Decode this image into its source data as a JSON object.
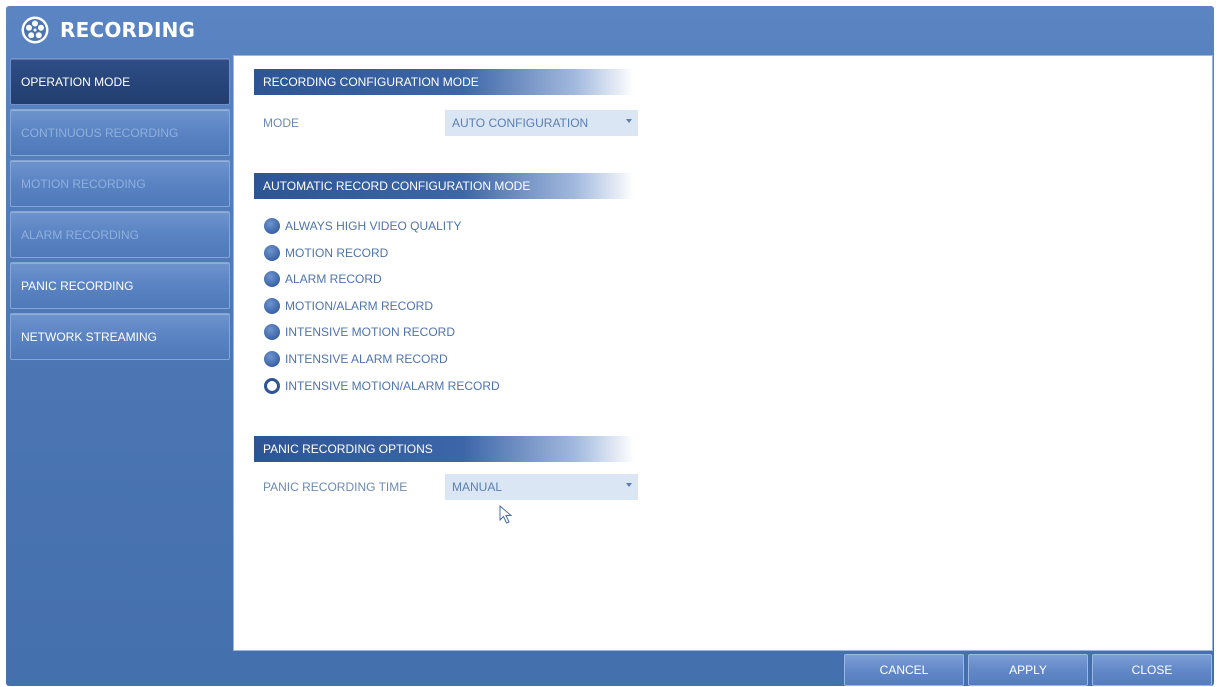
{
  "window": {
    "title": "RECORDING",
    "icon": "film-reel-icon"
  },
  "sidebar": {
    "items": [
      {
        "label": "OPERATION MODE",
        "state": "active"
      },
      {
        "label": "CONTINUOUS RECORDING",
        "state": "disabled"
      },
      {
        "label": "MOTION RECORDING",
        "state": "disabled"
      },
      {
        "label": "ALARM RECORDING",
        "state": "disabled"
      },
      {
        "label": "PANIC RECORDING",
        "state": "normal"
      },
      {
        "label": "NETWORK STREAMING",
        "state": "normal"
      }
    ]
  },
  "main": {
    "config_section": {
      "header": "RECORDING CONFIGURATION MODE",
      "mode_label": "MODE",
      "mode_value": "AUTO CONFIGURATION"
    },
    "auto_section": {
      "header": "AUTOMATIC RECORD CONFIGURATION MODE",
      "options": [
        {
          "label": "ALWAYS HIGH VIDEO QUALITY",
          "selected": false
        },
        {
          "label": "MOTION RECORD",
          "selected": false
        },
        {
          "label": "ALARM RECORD",
          "selected": false
        },
        {
          "label": "MOTION/ALARM RECORD",
          "selected": false
        },
        {
          "label": "INTENSIVE MOTION RECORD",
          "selected": false
        },
        {
          "label": "INTENSIVE ALARM RECORD",
          "selected": false
        },
        {
          "label": "INTENSIVE MOTION/ALARM RECORD",
          "selected": true
        }
      ]
    },
    "panic_section": {
      "header": "PANIC RECORDING OPTIONS",
      "time_label": "PANIC RECORDING TIME",
      "time_value": "MANUAL"
    }
  },
  "footer": {
    "cancel_label": "CANCEL",
    "apply_label": "APPLY",
    "close_label": "CLOSE"
  },
  "colors": {
    "window_bg": "#4e79b8",
    "section_header": "#2d5596",
    "active_tab": "#223e70",
    "text_blue": "#4f74ad"
  }
}
